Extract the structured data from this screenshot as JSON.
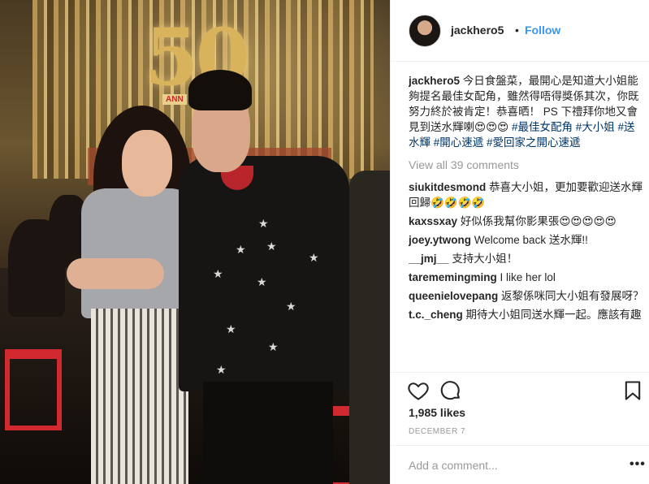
{
  "post": {
    "username": "jackhero5",
    "separator": "•",
    "follow_label": "Follow",
    "caption_text": "今日食盤菜，最開心是知道大小姐能夠提名最佳女配角，雖然得唔得獎係其次，你既努力終於被肯定！恭喜晒！ PS 下禮拜你地又會見到送水輝喇😍😍😍",
    "caption_tags": "#最佳女配角 #大小姐 #送水輝 #開心速遞 #愛回家之開心速遞",
    "view_all_label": "View all 39 comments",
    "likes": "1,985 likes",
    "date": "DECEMBER 7",
    "add_comment_placeholder": "Add a comment...",
    "more_label": "•••"
  },
  "photo": {
    "logo_text": "50",
    "logo_banner": "ANN"
  },
  "comments": [
    {
      "user": "siukitdesmond",
      "text": "恭喜大小姐，更加要歡迎送水輝回歸🤣🤣🤣🤣"
    },
    {
      "user": "kaxssxay",
      "text": "好似係我幫你影果張😍😍😍😍😍"
    },
    {
      "user": "joey.ytwong",
      "text": "Welcome back 送水輝!!"
    },
    {
      "user": "__jmj__",
      "text": "支持大小姐！"
    },
    {
      "user": "tarememingming",
      "text": "I like her lol"
    },
    {
      "user": "queenielovepang",
      "text": "返黎係咪同大小姐有發展呀？"
    },
    {
      "user": "t.c._cheng",
      "text": "期待大小姐同送水輝一起。應該有趣"
    }
  ],
  "icons": [
    "heart-icon",
    "comment-icon",
    "bookmark-icon"
  ],
  "colors": {
    "link": "#3897f0",
    "hashtag": "#003569",
    "muted": "#999999",
    "text": "#262626"
  }
}
